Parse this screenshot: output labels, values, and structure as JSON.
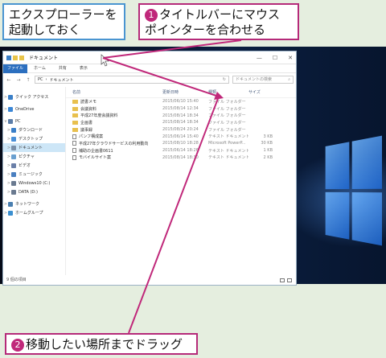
{
  "callouts": {
    "step0": {
      "line1": "エクスプローラーを",
      "line2": "起動しておく"
    },
    "step1": {
      "badge": "1",
      "line1": "タイトルバーにマウス",
      "line2": "ポインターを合わせる"
    },
    "step2": {
      "badge": "2",
      "text": "移動したい場所までドラッグ"
    }
  },
  "window": {
    "title": "ドキュメント",
    "controls": {
      "minimize": "—",
      "maximize": "☐",
      "close": "✕"
    },
    "ribbon_tabs": {
      "file": "ファイル",
      "home": "ホーム",
      "share": "共有",
      "view": "表示"
    },
    "nav": {
      "back": "←",
      "forward": "→",
      "up": "↑"
    },
    "address": {
      "pc": "PC",
      "sep": "›",
      "folder": "ドキュメント",
      "refresh": "↻"
    },
    "search_placeholder": "ドキュメントの検索",
    "columns": {
      "name": "名前",
      "date": "更新日時",
      "type": "種類",
      "size": "サイズ"
    },
    "sidebar": [
      {
        "label": "クイック アクセス",
        "caret": ">",
        "color": "#3a7fc8"
      },
      {
        "label": "OneDrive",
        "caret": ">",
        "color": "#3a86d6"
      },
      {
        "label": "PC",
        "caret": "v",
        "color": "#5b7da8"
      },
      {
        "label": "ダウンロード",
        "caret": ">",
        "color": "#3a7fc8"
      },
      {
        "label": "デスクトップ",
        "caret": ">",
        "color": "#4a90d8"
      },
      {
        "label": "ドキュメント",
        "caret": ">",
        "color": "#7a8fa8"
      },
      {
        "label": "ピクチャ",
        "caret": ">",
        "color": "#6aa0d0"
      },
      {
        "label": "ビデオ",
        "caret": ">",
        "color": "#6a7fa8"
      },
      {
        "label": "ミュージック",
        "caret": ">",
        "color": "#4a7fc0"
      },
      {
        "label": "Windows10 (C:)",
        "caret": ">",
        "color": "#6a7a90"
      },
      {
        "label": "DATA (D:)",
        "caret": ">",
        "color": "#6a7a90"
      },
      {
        "label": "ネットワーク",
        "caret": ">",
        "color": "#4a7fb0"
      },
      {
        "label": "ホームグループ",
        "caret": ">",
        "color": "#3a8fd0"
      }
    ],
    "files": [
      {
        "name": "読書メモ",
        "date": "2015/06/10 15:40",
        "type": "ファイル フォルダー",
        "size": "",
        "kind": "folder"
      },
      {
        "name": "会議資料",
        "date": "2015/08/14 12:34",
        "type": "ファイル フォルダー",
        "size": "",
        "kind": "folder"
      },
      {
        "name": "平成27年度会議資料",
        "date": "2015/08/14 18:34",
        "type": "ファイル フォルダー",
        "size": "",
        "kind": "folder"
      },
      {
        "name": "企画書",
        "date": "2015/08/14 18:34",
        "type": "ファイル フォルダー",
        "size": "",
        "kind": "folder"
      },
      {
        "name": "議事録",
        "date": "2015/08/24 20:24",
        "type": "ファイル フォルダー",
        "size": "",
        "kind": "folder"
      },
      {
        "name": "パンフ構成案",
        "date": "2015/06/14 15:40",
        "type": "テキスト ドキュメント",
        "size": "3 KB",
        "kind": "file"
      },
      {
        "name": "平成27年クラウドサービスの利用動向",
        "date": "2015/08/10 18:28",
        "type": "Microsoft PowerP...",
        "size": "30 KB",
        "kind": "file"
      },
      {
        "name": "補助の企画書0611",
        "date": "2015/06/14 18:26",
        "type": "テキスト ドキュメント",
        "size": "1 KB",
        "kind": "file"
      },
      {
        "name": "モバイルサイト案",
        "date": "2015/08/14 18:30",
        "type": "テキスト ドキュメント",
        "size": "2 KB",
        "kind": "file"
      }
    ],
    "status": "9 個の項目"
  },
  "colors": {
    "accent_magenta": "#b52a79",
    "accent_blue": "#4a95d1",
    "ribbon_file": "#2c6fbf"
  }
}
